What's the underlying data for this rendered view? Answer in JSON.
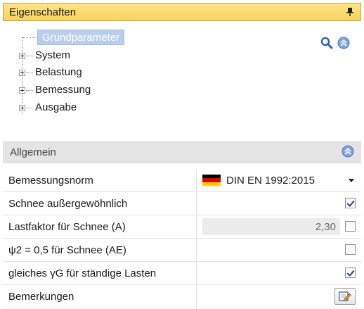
{
  "panel": {
    "title": "Eigenschaften",
    "colors": {
      "title_bg": "#f8d25c",
      "selected_node": "#b9cdee",
      "accent_blue": "#4a74c9"
    }
  },
  "tree": {
    "selected": "Grundparameter",
    "items": [
      "System",
      "Belastung",
      "Bemessung",
      "Ausgabe"
    ]
  },
  "section": {
    "title": "Allgemein"
  },
  "properties": [
    {
      "label": "Bemessungsnorm",
      "value": "DIN EN 1992:2015",
      "type": "dropdown",
      "icon": "german-flag-icon"
    },
    {
      "label": "Schnee außergewöhnlich",
      "type": "checkbox",
      "checked": true
    },
    {
      "label": "Lastfaktor für Schnee (A)",
      "value": "2,30",
      "type": "readonly-checkbox",
      "checked": false
    },
    {
      "label": " ψ2 = 0,5 für Schnee (AE)",
      "type": "checkbox",
      "checked": false
    },
    {
      "label": "gleiches γG für ständige Lasten",
      "type": "checkbox",
      "checked": true
    },
    {
      "label": "Bemerkungen",
      "type": "edit-button",
      "icon": "edit-icon"
    }
  ]
}
